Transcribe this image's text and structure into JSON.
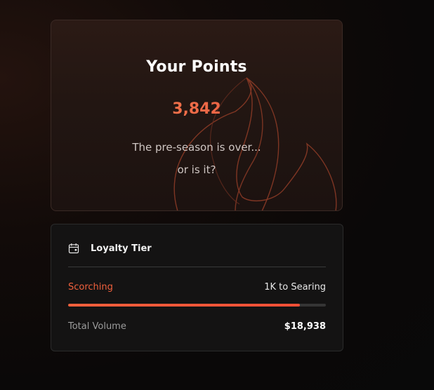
{
  "points_card": {
    "title": "Your Points",
    "value": "3,842",
    "message_line1": "The pre-season is over...",
    "message_line2": "or is it?",
    "decoration_icon": "flame-icon"
  },
  "tier_card": {
    "icon": "calendar-icon",
    "label": "Loyalty Tier",
    "current_tier": "Scorching",
    "next_tier_text": "1K to Searing",
    "progress": 0.9,
    "volume_label": "Total Volume",
    "volume_value": "$18,938"
  },
  "colors": {
    "accent": "#f0603c",
    "points_gradient_start": "#f38b55",
    "points_gradient_end": "#ea4a3a"
  }
}
